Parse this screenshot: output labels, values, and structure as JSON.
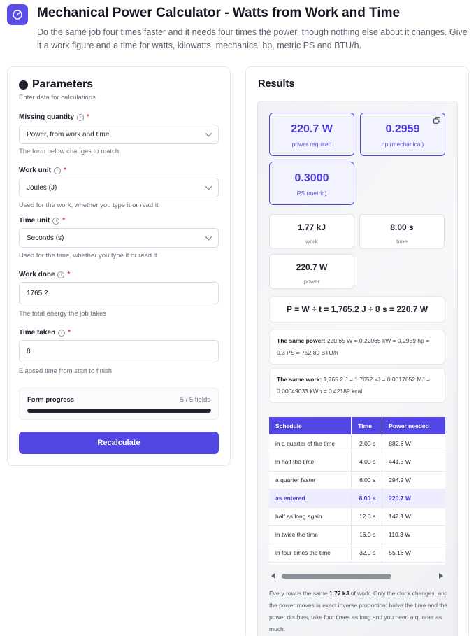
{
  "header": {
    "title": "Mechanical Power Calculator - Watts from Work and Time",
    "subtitle": "Do the same job four times faster and it needs four times the power, though nothing else about it changes. Give it a work figure and a time for watts, kilowatts, mechanical hp, metric PS and BTU/h."
  },
  "params": {
    "title": "Parameters",
    "subtitle": "Enter data for calculations",
    "missing": {
      "label": "Missing quantity",
      "value": "Power, from work and time",
      "hint": "The form below changes to match"
    },
    "work_unit": {
      "label": "Work unit",
      "value": "Joules (J)",
      "hint": "Used for the work, whether you type it or read it"
    },
    "time_unit": {
      "label": "Time unit",
      "value": "Seconds (s)",
      "hint": "Used for the time, whether you type it or read it"
    },
    "work_done": {
      "label": "Work done",
      "value": "1765.2",
      "hint": "The total energy the job takes"
    },
    "time_taken": {
      "label": "Time taken",
      "value": "8",
      "hint": "Elapsed time from start to finish"
    },
    "required_mark": "*",
    "progress": {
      "label": "Form progress",
      "count": "5 / 5 fields",
      "fraction": 1.0
    },
    "button": "Recalculate"
  },
  "results": {
    "title": "Results",
    "tiles": [
      {
        "value": "220.7 W",
        "unit": "power required"
      },
      {
        "value": "0.2959",
        "unit": "hp (mechanical)"
      },
      {
        "value": "0.3000",
        "unit": "PS (metric)"
      }
    ],
    "plain_tiles": [
      {
        "value": "1.77 kJ",
        "unit": "work"
      },
      {
        "value": "8.00 s",
        "unit": "time"
      },
      {
        "value": "220.7 W",
        "unit": "power"
      }
    ],
    "formula": "P = W ÷ t = 1,765.2 J ÷ 8 s = 220.7 W",
    "power_note": {
      "label": "The same power:",
      "text": "220.65 W = 0.22065 kW = 0.2959 hp = 0.3 PS = 752.89 BTU/h"
    },
    "work_note": {
      "label": "The same work:",
      "text": "1,765.2 J = 1.7652 kJ = 0.0017652 MJ = 0.00049033 kWh = 0.42189 kcal"
    },
    "table": {
      "headers": [
        "Schedule",
        "Time",
        "Power needed"
      ],
      "rows": [
        [
          "in a quarter of the time",
          "2.00 s",
          "882.6 W"
        ],
        [
          "in half the time",
          "4.00 s",
          "441.3 W"
        ],
        [
          "a quarter faster",
          "6.00 s",
          "294.2 W"
        ],
        [
          "as entered",
          "8.00 s",
          "220.7 W"
        ],
        [
          "half as long again",
          "12.0 s",
          "147.1 W"
        ],
        [
          "in twice the time",
          "16.0 s",
          "110.3 W"
        ],
        [
          "in four times the time",
          "32.0 s",
          "55.16 W"
        ]
      ]
    },
    "footnote": {
      "before": "Every row is the same ",
      "bold": "1.77 kJ",
      "after": " of work. Only the clock changes, and the power moves in exact inverse proportion: halve the time and the power doubles, take four times as long and you need a quarter as much."
    }
  }
}
